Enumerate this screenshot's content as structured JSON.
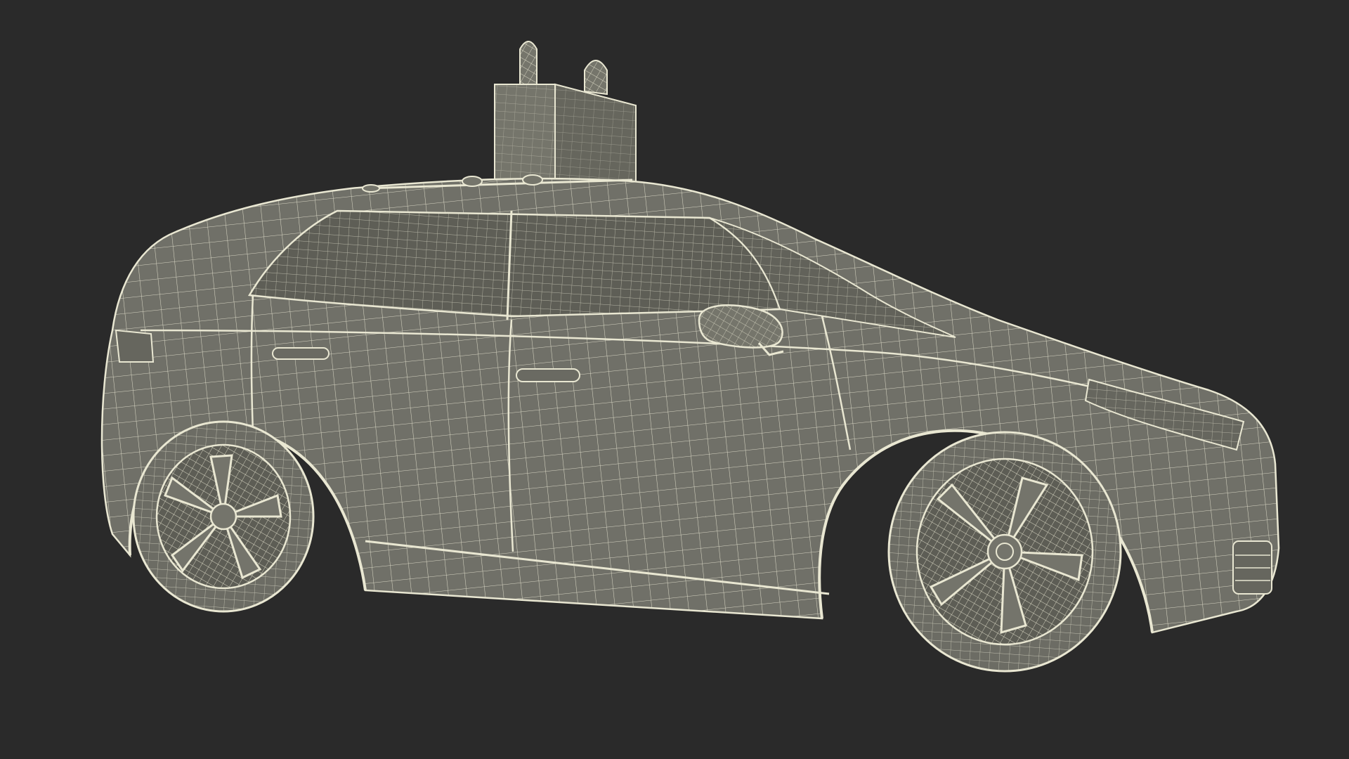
{
  "scene": {
    "background_color": "#2a2a2a",
    "mesh_fill_color": "#6e6e64",
    "mesh_shade_color": "#5a5a52",
    "wire_color": "#e9e7d2",
    "subject": "wireframe-car-with-roof-sensor-pod"
  }
}
